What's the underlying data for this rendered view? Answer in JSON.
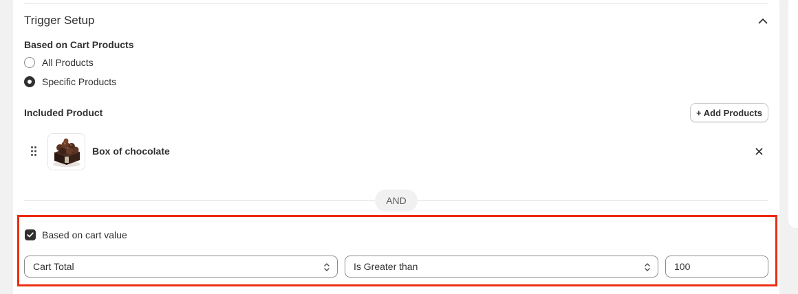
{
  "trigger_setup": {
    "title": "Trigger Setup",
    "collapse_icon": "chevron-up-icon",
    "cart_products": {
      "label": "Based on Cart Products",
      "options": [
        {
          "label": "All Products",
          "selected": false
        },
        {
          "label": "Specific Products",
          "selected": true
        }
      ]
    },
    "included_product": {
      "label": "Included Product",
      "add_button_label": "+ Add Products",
      "items": [
        {
          "name": "Box of chocolate",
          "thumbnail_icon": "chocolate-box-image",
          "remove_icon": "close-icon",
          "drag_icon": "drag-handle-icon"
        }
      ]
    },
    "separator_label": "AND",
    "cart_value": {
      "checkbox_label": "Based on cart value",
      "checked": true,
      "field_select": {
        "value": "Cart Total"
      },
      "operator_select": {
        "value": "Is Greater than"
      },
      "amount_input": {
        "value": "100"
      }
    }
  },
  "colors": {
    "highlight_border": "#ee2a10",
    "background": "#f1f1f1",
    "card": "#ffffff",
    "text": "#303030"
  }
}
